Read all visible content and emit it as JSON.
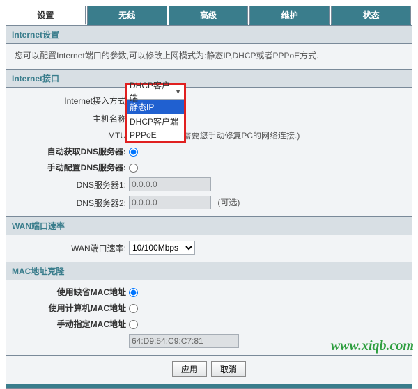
{
  "tabs": {
    "t0": "设置",
    "t1": "无线",
    "t2": "高级",
    "t3": "维护",
    "t4": "状态"
  },
  "internetSettings": {
    "title": "Internet设置",
    "desc": "您可以配置Internet端口的参数,可以修改上网模式为:静态IP,DHCP或者PPPoE方式."
  },
  "internetIf": {
    "title": "Internet接口",
    "labels": {
      "access": "Internet接入方式",
      "host": "主机名称",
      "mtu": "MTU",
      "autoDns": "自动获取DNS服务器:",
      "manualDns": "手动配置DNS服务器:",
      "dns1": "DNS服务器1:",
      "dns2": "DNS服务器2:"
    },
    "selected": "DHCP客户端",
    "options": {
      "o1": "静态IP",
      "o2": "DHCP客户端",
      "o3": "PPPoE"
    },
    "hint": "置后需要您手动修复PC的网络连接.)",
    "dns1": "0.0.0.0",
    "dns2": "0.0.0.0",
    "optional": "(可选)"
  },
  "wan": {
    "title": "WAN端口速率",
    "label": "WAN端口速率:",
    "value": "10/100Mbps"
  },
  "mac": {
    "title": "MAC地址克隆",
    "labels": {
      "def": "使用缺省MAC地址",
      "pc": "使用计算机MAC地址",
      "man": "手动指定MAC地址"
    },
    "value": "64:D9:54:C9:C7:81"
  },
  "buttons": {
    "apply": "应用",
    "cancel": "取消"
  },
  "watermark": "www.xiqb.com"
}
